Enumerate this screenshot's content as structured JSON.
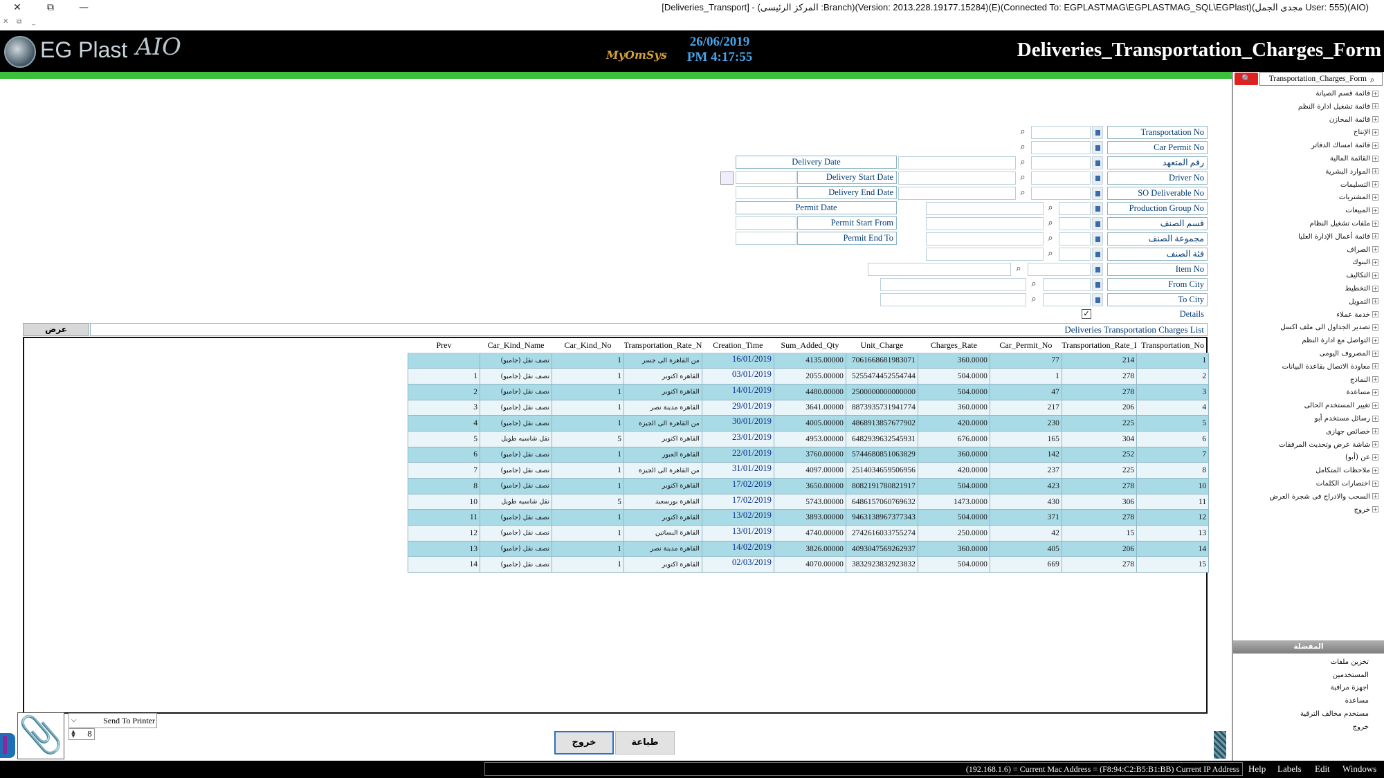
{
  "window": {
    "title": "[Deliveries_Transport] - (المركز الرئيسى :Branch)(Version: 2013.228.19177.15284)(E)(Connected To: EGPLASTMAG\\EGPLASTMAG_SQL\\EGPlast)(مجدى الجمل User: 555)(AIO)",
    "close": "✕",
    "restore": "⧉",
    "minimize": "—",
    "sub_close": "✕",
    "sub_restore": "⧉",
    "sub_min": "_"
  },
  "header": {
    "logo_text": "EG Plast",
    "logo_sig": "AIO",
    "brand": "MyOmSys",
    "date": "26/06/2019",
    "time": "PM 4:17:55",
    "form_title": "Deliveries_Transportation_Charges_Form"
  },
  "form": {
    "transportation_no": "Transportation No",
    "car_permit_no": "Car Permit No",
    "commitment_no": "رقم المتعهد",
    "driver_no": "Driver No",
    "so_deliverable_no": "SO Deliverable No",
    "production_group_no": "Production Group No",
    "item_section": "قسم الصنف",
    "item_group": "مجموعة الصنف",
    "item_category": "فئة الصنف",
    "item_no": "Item No",
    "from_city": "From City",
    "to_city": "To City",
    "details": "Details",
    "delivery_date": "Delivery Date",
    "delivery_start_date": "Delivery Start Date",
    "delivery_end_date": "Delivery End Date",
    "permit_date": "Permit Date",
    "permit_start_from": "Permit Start From",
    "permit_end_to": "Permit End To"
  },
  "list": {
    "title": "Deliveries Transportation Charges List",
    "view_button": "عرض",
    "columns": [
      "Prev",
      "Car_Kind_Name",
      "Car_Kind_No",
      "Transportation_Rate_N",
      "Creation_Time",
      "Sum_Added_Qty",
      "Unit_Charge",
      "Charges_Rate",
      "Car_Permit_No",
      "Transportation_Rate_I",
      "Transportation_No"
    ],
    "rows": [
      {
        "prev": "",
        "car_kind_name": "نصف نقل (جامبو)",
        "car_kind_no": "1",
        "rate_name": "من القاهرة الى جسر",
        "creation_time": "16/01/2019",
        "sum_added_qty": "4135.00000",
        "unit_charge": "7061668681983071",
        "charges_rate": "360.0000",
        "car_permit_no": "77",
        "rate_id": "214",
        "transportation_no": "1"
      },
      {
        "prev": "1",
        "car_kind_name": "نصف نقل (جامبو)",
        "car_kind_no": "1",
        "rate_name": "القاهرة اكتوبر",
        "creation_time": "03/01/2019",
        "sum_added_qty": "2055.00000",
        "unit_charge": "5255474452554744",
        "charges_rate": "504.0000",
        "car_permit_no": "1",
        "rate_id": "278",
        "transportation_no": "2"
      },
      {
        "prev": "2",
        "car_kind_name": "نصف نقل (جامبو)",
        "car_kind_no": "1",
        "rate_name": "القاهرة اكتوبر",
        "creation_time": "14/01/2019",
        "sum_added_qty": "4480.00000",
        "unit_charge": "2500000000000000",
        "charges_rate": "504.0000",
        "car_permit_no": "47",
        "rate_id": "278",
        "transportation_no": "3"
      },
      {
        "prev": "3",
        "car_kind_name": "نصف نقل (جامبو)",
        "car_kind_no": "1",
        "rate_name": "القاهرة مدينة نصر",
        "creation_time": "29/01/2019",
        "sum_added_qty": "3641.00000",
        "unit_charge": "8873935731941774",
        "charges_rate": "360.0000",
        "car_permit_no": "217",
        "rate_id": "206",
        "transportation_no": "4"
      },
      {
        "prev": "4",
        "car_kind_name": "نصف نقل (جامبو)",
        "car_kind_no": "1",
        "rate_name": "من القاهرة الى الجيزة",
        "creation_time": "30/01/2019",
        "sum_added_qty": "4005.00000",
        "unit_charge": "4868913857677902",
        "charges_rate": "420.0000",
        "car_permit_no": "230",
        "rate_id": "225",
        "transportation_no": "5"
      },
      {
        "prev": "5",
        "car_kind_name": "نقل شاسيه طويل",
        "car_kind_no": "5",
        "rate_name": "القاهرة اكتوبر",
        "creation_time": "23/01/2019",
        "sum_added_qty": "4953.00000",
        "unit_charge": "6482939632545931",
        "charges_rate": "676.0000",
        "car_permit_no": "165",
        "rate_id": "304",
        "transportation_no": "6"
      },
      {
        "prev": "6",
        "car_kind_name": "نصف نقل (جامبو)",
        "car_kind_no": "1",
        "rate_name": "القاهرة العبور",
        "creation_time": "22/01/2019",
        "sum_added_qty": "3760.00000",
        "unit_charge": "5744680851063829",
        "charges_rate": "360.0000",
        "car_permit_no": "142",
        "rate_id": "252",
        "transportation_no": "7"
      },
      {
        "prev": "7",
        "car_kind_name": "نصف نقل (جامبو)",
        "car_kind_no": "1",
        "rate_name": "من القاهرة الى الجيزة",
        "creation_time": "31/01/2019",
        "sum_added_qty": "4097.00000",
        "unit_charge": "2514034659506956",
        "charges_rate": "420.0000",
        "car_permit_no": "237",
        "rate_id": "225",
        "transportation_no": "8"
      },
      {
        "prev": "8",
        "car_kind_name": "نصف نقل (جامبو)",
        "car_kind_no": "1",
        "rate_name": "القاهرة اكتوبر",
        "creation_time": "17/02/2019",
        "sum_added_qty": "3650.00000",
        "unit_charge": "8082191780821917",
        "charges_rate": "504.0000",
        "car_permit_no": "423",
        "rate_id": "278",
        "transportation_no": "10"
      },
      {
        "prev": "10",
        "car_kind_name": "نقل شاسيه طويل",
        "car_kind_no": "5",
        "rate_name": "القاهرة بورسعيد",
        "creation_time": "17/02/2019",
        "sum_added_qty": "5743.00000",
        "unit_charge": "6486157060769632",
        "charges_rate": "1473.0000",
        "car_permit_no": "430",
        "rate_id": "306",
        "transportation_no": "11"
      },
      {
        "prev": "11",
        "car_kind_name": "نصف نقل (جامبو)",
        "car_kind_no": "1",
        "rate_name": "القاهرة اكتوبر",
        "creation_time": "13/02/2019",
        "sum_added_qty": "3893.00000",
        "unit_charge": "9463138967377343",
        "charges_rate": "504.0000",
        "car_permit_no": "371",
        "rate_id": "278",
        "transportation_no": "12"
      },
      {
        "prev": "12",
        "car_kind_name": "نصف نقل (جامبو)",
        "car_kind_no": "1",
        "rate_name": "القاهرة البساتين",
        "creation_time": "13/01/2019",
        "sum_added_qty": "4740.00000",
        "unit_charge": "2742616033755274",
        "charges_rate": "250.0000",
        "car_permit_no": "42",
        "rate_id": "15",
        "transportation_no": "13"
      },
      {
        "prev": "13",
        "car_kind_name": "نصف نقل (جامبو)",
        "car_kind_no": "1",
        "rate_name": "القاهرة مدينة نصر",
        "creation_time": "14/02/2019",
        "sum_added_qty": "3826.00000",
        "unit_charge": "4093047569262937",
        "charges_rate": "360.0000",
        "car_permit_no": "405",
        "rate_id": "206",
        "transportation_no": "14"
      },
      {
        "prev": "14",
        "car_kind_name": "نصف نقل (جامبو)",
        "car_kind_no": "1",
        "rate_name": "القاهرة اكتوبر",
        "creation_time": "02/03/2019",
        "sum_added_qty": "4070.00000",
        "unit_charge": "3832923832923832",
        "charges_rate": "504.0000",
        "car_permit_no": "669",
        "rate_id": "278",
        "transportation_no": "15"
      }
    ]
  },
  "bottom": {
    "send_to_printer": "Send To Printer",
    "copies": "8",
    "exit_button": "خروج",
    "print_button": "طباعة"
  },
  "statusbar": {
    "ip_text": "(192.168.1.6) = Current Mac Address = (F8:94:C2:B5:B1:BB) Current IP Address",
    "menu": [
      "Help",
      "Labels",
      "Edit",
      "Windows"
    ]
  },
  "sidebar": {
    "search_value": "Transportation_Charges_Form",
    "tree": [
      "قائمة قسم الصيانة",
      "قائمة تشغيل ادارة النظم",
      "قائمة المخازن",
      "الإنتاج",
      "قائمة امساك الدفاتر",
      "القائمة المالية",
      "الموارد البشرية",
      "التسليمات",
      "المشتريات",
      "المبيعات",
      "ملفات تشغيل النظام",
      "قائمة أعمال الإدارة العليا",
      "الصراف",
      "البنوك",
      "التكاليف",
      "التخطيط",
      "التمويل",
      "خدمة عملاء",
      "تصدير الجداول الى ملف اكسل",
      "التواصل مع ادارة النظم",
      "المصروف اليومى",
      "معاودة الاتصال بقاعدة البيانات",
      "النماذج",
      "مساعدة",
      "تغيير المستخدم الحالى",
      "رسائل مستخدم أبو",
      "خصائص جهازى",
      "شاشة عرض وتحديث المرفقات",
      "عن (أبو)",
      "ملاحظات المتكامل",
      "اختصارات الكلمات",
      "السحب والادراج فى شجرة العرض",
      "خروج"
    ],
    "favorites_title": "المفضلة",
    "favorites": [
      "تخزين ملفات",
      "المستخدمين",
      "اجهزة مراقبة",
      "مساعدة",
      "مستخدم مخالف الترقية",
      "خروج"
    ]
  }
}
